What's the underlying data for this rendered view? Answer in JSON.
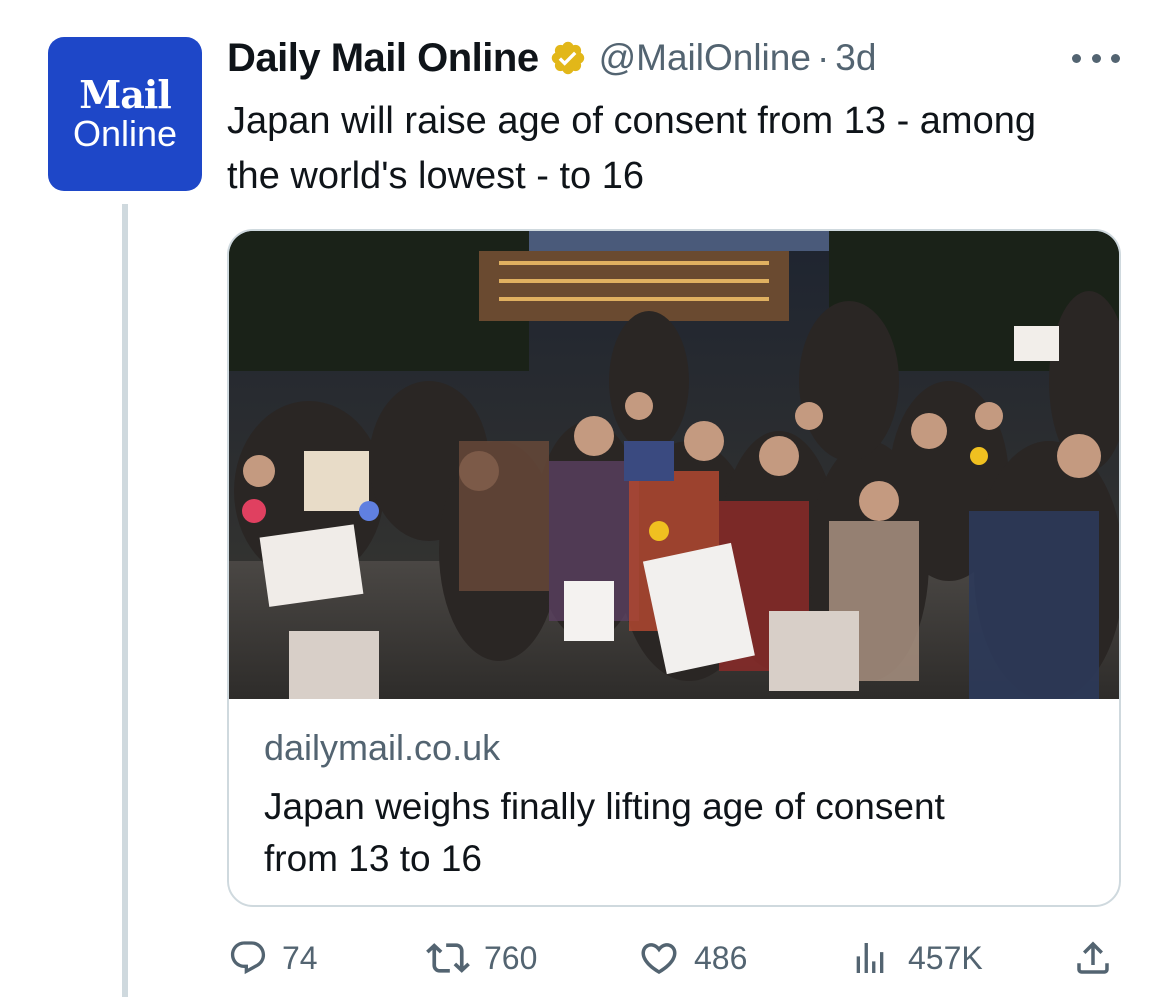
{
  "tweet": {
    "avatar": {
      "line1": "Mail",
      "line2": "Online",
      "bg_color": "#1e47c8"
    },
    "author": {
      "name": "Daily Mail Online",
      "verified": true,
      "verified_badge": "gold-checkmark-badge-icon",
      "handle": "@MailOnline",
      "separator": "·",
      "time": "3d"
    },
    "text": "Japan will raise age of consent from 13 - among the world's lowest - to 16",
    "card": {
      "image_alt": "photo-of-seated-protesters-at-night",
      "domain": "dailymail.co.uk",
      "title": "Japan weighs finally lifting age of consent from 13 to 16"
    },
    "actions": {
      "replies": "74",
      "retweets": "760",
      "likes": "486",
      "views": "457K",
      "share_icon": "share-icon"
    }
  },
  "colors": {
    "text": "#0f1419",
    "secondary": "#536471",
    "border": "#cfd9de",
    "gold": "#e2b719"
  }
}
